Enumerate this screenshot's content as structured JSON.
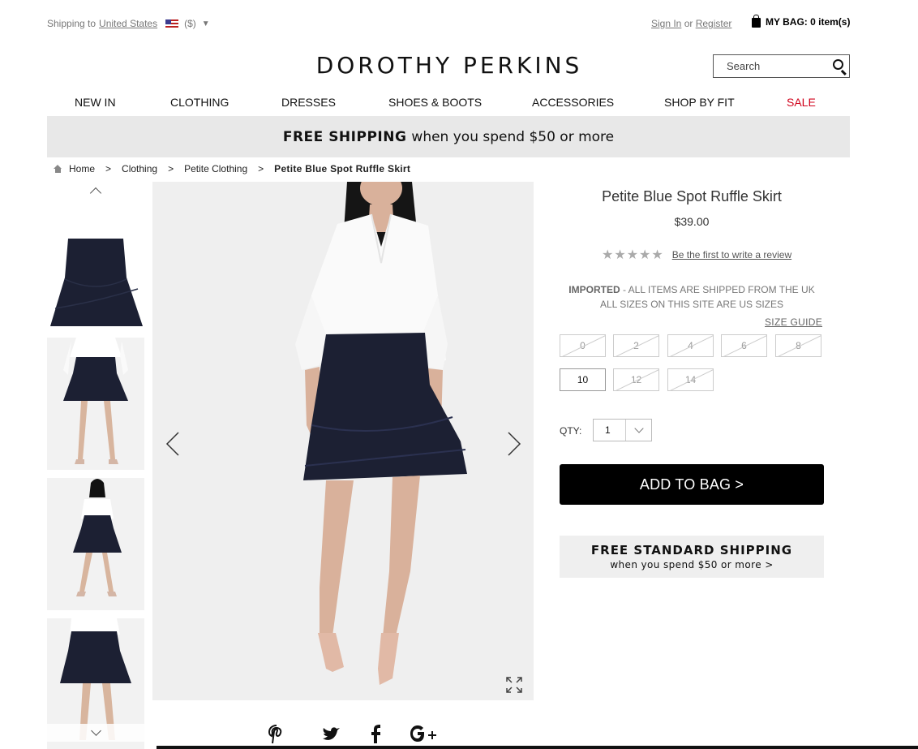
{
  "topbar": {
    "shipping_prefix": "Shipping to",
    "country": "United States",
    "currency": "($)",
    "currency_caret": "▼"
  },
  "account": {
    "sign_in": "Sign In",
    "or": " or ",
    "register": "Register",
    "bag_label": "MY BAG: 0 item(s)"
  },
  "logo": "DOROTHY PERKINS",
  "search": {
    "placeholder": "Search"
  },
  "nav": {
    "items": [
      "NEW IN",
      "CLOTHING",
      "DRESSES",
      "SHOES & BOOTS",
      "ACCESSORIES",
      "SHOP BY FIT",
      "SALE"
    ],
    "sale_color": "#d0021b"
  },
  "promo": {
    "bold": "FREE SHIPPING",
    "rest": "when you spend $50 or more"
  },
  "breadcrumb": {
    "items": [
      "Home",
      "Clothing",
      "Petite Clothing"
    ],
    "separator": ">",
    "current": "Petite Blue Spot Ruffle Skirt"
  },
  "product": {
    "title": "Petite Blue Spot Ruffle Skirt",
    "price": "$39.00",
    "stars": "★★★★★",
    "review_link": "Be the first to write a review",
    "imported_bold": "IMPORTED",
    "imported_rest": " - ALL ITEMS ARE SHIPPED FROM THE UK",
    "sizes_note": "ALL SIZES ON THIS SITE ARE US SIZES",
    "size_guide": "SIZE GUIDE",
    "sizes": [
      {
        "label": "0",
        "available": false
      },
      {
        "label": "2",
        "available": false
      },
      {
        "label": "4",
        "available": false
      },
      {
        "label": "6",
        "available": false
      },
      {
        "label": "8",
        "available": false
      },
      {
        "label": "10",
        "available": true
      },
      {
        "label": "12",
        "available": false
      },
      {
        "label": "14",
        "available": false
      }
    ],
    "qty_label": "QTY:",
    "qty_value": "1",
    "add_to_bag": "ADD TO BAG >",
    "ship_heading": "FREE STANDARD SHIPPING",
    "ship_sub": "when you spend $50 or more >"
  },
  "social": [
    "pinterest-icon",
    "twitter-icon",
    "facebook-icon",
    "google-plus-icon"
  ],
  "colors": {
    "skirt": "#1c2033",
    "promo_bg": "#e8e8e8",
    "button": "#000000"
  }
}
